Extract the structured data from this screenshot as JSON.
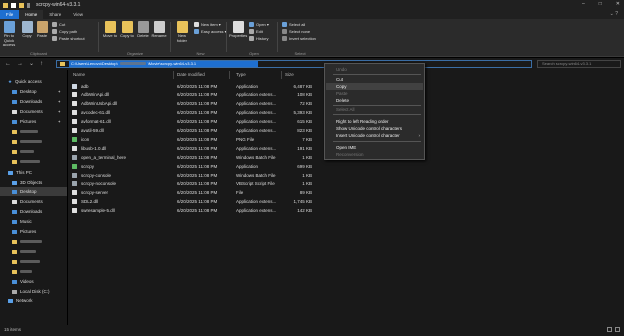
{
  "window": {
    "title": "scrcpy-win64-v3.3.1",
    "controls": [
      "–",
      "□",
      "✕"
    ]
  },
  "tabs": [
    {
      "label": "File"
    },
    {
      "label": "Home"
    },
    {
      "label": "Share"
    },
    {
      "label": "View"
    }
  ],
  "ribbon": {
    "clipboard": {
      "pin_label": "Pin to Quick access",
      "copy_label": "Copy",
      "paste_label": "Paste",
      "cut_label": "Cut",
      "copy_path_label": "Copy path",
      "paste_shortcut_label": "Paste shortcut",
      "group_label": "Clipboard"
    },
    "organize": {
      "move_to_label": "Move to",
      "copy_to_label": "Copy to",
      "delete_label": "Delete",
      "rename_label": "Rename",
      "group_label": "Organize"
    },
    "new": {
      "new_folder_label": "New folder",
      "new_item_label": "New item ▾",
      "easy_access_label": "Easy access ▾",
      "group_label": "New"
    },
    "open": {
      "properties_label": "Properties",
      "open_label": "Open ▾",
      "edit_label": "Edit",
      "history_label": "History",
      "group_label": "Open"
    },
    "select": {
      "select_all_label": "Select all",
      "select_none_label": "Select none",
      "invert_label": "Invert selection",
      "group_label": "Select"
    }
  },
  "address": {
    "path_visible": "C:\\Users\\Lenovo\\Desktop\\",
    "path_tail": "\\Movie\\scrcpy-win64-v3.3.1",
    "search_placeholder": "Search scrcpy-win64-v3.3.1"
  },
  "nav": {
    "items": [
      {
        "label": "Quick access"
      },
      {
        "label": "Desktop"
      },
      {
        "label": "Downloads"
      },
      {
        "label": "Documents"
      },
      {
        "label": "Pictures"
      },
      {
        "label": "This PC"
      },
      {
        "label": "3D Objects"
      },
      {
        "label": "Desktop"
      },
      {
        "label": "Documents"
      },
      {
        "label": "Downloads"
      },
      {
        "label": "Music"
      },
      {
        "label": "Pictures"
      },
      {
        "label": "Videos"
      },
      {
        "label": "Local Disk (C:)"
      },
      {
        "label": "Network"
      }
    ]
  },
  "columns": {
    "name": "Name",
    "date": "Date modified",
    "type": "Type",
    "size": "Size"
  },
  "files": [
    {
      "name": "adb",
      "date": "6/20/2025 11:08 PM",
      "type": "Application",
      "size": "6,487 KB",
      "color": "#cfd8e3"
    },
    {
      "name": "AdbWinApi.dll",
      "date": "6/20/2025 11:08 PM",
      "type": "Application extens...",
      "size": "108 KB",
      "color": "#e0e0e0"
    },
    {
      "name": "AdbWinUsbApi.dll",
      "date": "6/20/2025 11:08 PM",
      "type": "Application extens...",
      "size": "72 KB",
      "color": "#e0e0e0"
    },
    {
      "name": "avcodec-61.dll",
      "date": "6/20/2025 11:08 PM",
      "type": "Application extens...",
      "size": "5,393 KB",
      "color": "#e0e0e0"
    },
    {
      "name": "avformat-61.dll",
      "date": "6/20/2025 11:08 PM",
      "type": "Application extens...",
      "size": "615 KB",
      "color": "#e0e0e0"
    },
    {
      "name": "avutil-59.dll",
      "date": "6/20/2025 11:08 PM",
      "type": "Application extens...",
      "size": "823 KB",
      "color": "#e0e0e0"
    },
    {
      "name": "icon",
      "date": "6/20/2025 11:08 PM",
      "type": "PNG File",
      "size": "7 KB",
      "color": "#5dbb63"
    },
    {
      "name": "libusb-1.0.dll",
      "date": "6/20/2025 11:08 PM",
      "type": "Application extens...",
      "size": "191 KB",
      "color": "#e0e0e0"
    },
    {
      "name": "open_a_terminal_here",
      "date": "6/20/2025 11:08 PM",
      "type": "Windows Batch File",
      "size": "1 KB",
      "color": "#9aa4ad"
    },
    {
      "name": "scrcpy",
      "date": "6/20/2025 11:08 PM",
      "type": "Application",
      "size": "699 KB",
      "color": "#5dbb63"
    },
    {
      "name": "scrcpy-console",
      "date": "6/20/2025 11:08 PM",
      "type": "Windows Batch File",
      "size": "1 KB",
      "color": "#9aa4ad"
    },
    {
      "name": "scrcpy-noconsole",
      "date": "6/20/2025 11:08 PM",
      "type": "VBScript Script File",
      "size": "1 KB",
      "color": "#9aa4ad"
    },
    {
      "name": "scrcpy-server",
      "date": "6/20/2025 11:08 PM",
      "type": "File",
      "size": "89 KB",
      "color": "#e0e0e0"
    },
    {
      "name": "SDL2.dll",
      "date": "6/20/2025 11:08 PM",
      "type": "Application extens...",
      "size": "1,745 KB",
      "color": "#e0e0e0"
    },
    {
      "name": "swresample-5.dll",
      "date": "6/20/2025 11:08 PM",
      "type": "Application extens...",
      "size": "142 KB",
      "color": "#e0e0e0"
    }
  ],
  "context_menu": {
    "undo": "Undo",
    "cut": "Cut",
    "copy": "Copy",
    "paste": "Paste",
    "delete": "Delete",
    "select_all": "Select All",
    "rtl": "Right to left Reading order",
    "show_unicode": "Show Unicode control characters",
    "insert_unicode": "Insert Unicode control character",
    "open_ime": "Open IME",
    "reconversion": "Reconversion"
  },
  "status": {
    "items": "15 items"
  }
}
